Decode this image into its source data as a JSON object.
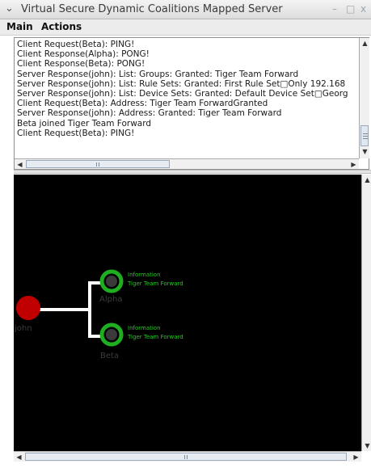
{
  "window": {
    "title": "Virtual Secure Dynamic Coalitions Mapped Server",
    "chevron_icon": "chevron-down-icon",
    "minimize_glyph": "–",
    "maximize_glyph": "□",
    "close_glyph": "x"
  },
  "menu": {
    "items": [
      "Main",
      "Actions"
    ]
  },
  "log": {
    "lines": [
      "Client Request(Beta): PING!",
      "Client Response(Alpha): PONG!",
      "Client Response(Beta): PONG!",
      "Server Response(john): List: Groups: Granted: Tiger Team Forward",
      "Server Response(john): List: Rule Sets: Granted: First Rule Set□Only 192.168",
      "Server Response(john): List: Device Sets: Granted: Default Device Set□Georg",
      "Client Request(Beta): Address: Tiger Team ForwardGranted",
      "Server Response(john): Address: Granted: Tiger Team Forward",
      "Beta joined Tiger Team Forward",
      "Client Request(Beta): PING!"
    ]
  },
  "graph": {
    "root": {
      "name": "john",
      "color": "#c00000"
    },
    "children": [
      {
        "name": "Alpha",
        "info": "Information",
        "group": "Tiger Team Forward"
      },
      {
        "name": "Beta",
        "info": "Information",
        "group": "Tiger Team Forward"
      }
    ],
    "child_ring_color": "#1fae1f",
    "child_core_color": "#3a3a3a",
    "link_color": "#ffffff"
  }
}
